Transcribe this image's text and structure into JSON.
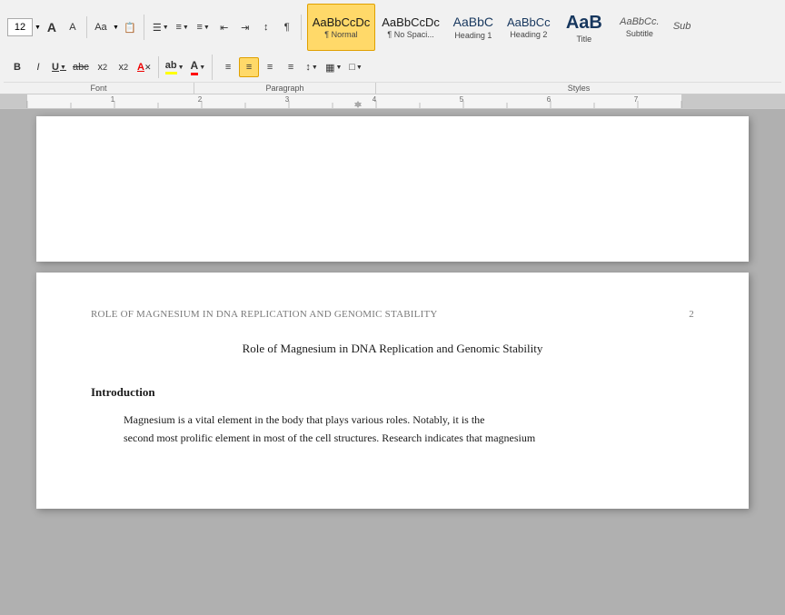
{
  "toolbar": {
    "font_size": "12",
    "row1": {
      "font_size_label": "12",
      "grow_btn": "A",
      "shrink_btn": "A",
      "font_name": "Aa",
      "copy_format": "copy-format",
      "bullets_btn": "≡",
      "numbered_btn": "≡",
      "multilevel_btn": "≡",
      "decrease_indent": "⇤",
      "increase_indent": "⇥",
      "sort_btn": "↕",
      "show_marks": "¶"
    },
    "row2": {
      "bold": "B",
      "italic": "I",
      "underline": "U",
      "strikethrough": "S",
      "subscript": "x₂",
      "superscript": "x²",
      "clear_fmt": "A",
      "highlight": "ab",
      "font_color": "A",
      "align_left": "≡",
      "align_center": "≡",
      "align_right": "≡",
      "justify": "≡",
      "line_spacing": "↕",
      "shading": "▦",
      "borders": "□"
    }
  },
  "styles": {
    "normal": {
      "preview": "AaBbCcDc",
      "label": "¶ Normal",
      "active": true
    },
    "no_spacing": {
      "preview": "AaBbCcDc",
      "label": "¶ No Spaci..."
    },
    "heading1": {
      "preview": "AaBbC",
      "label": "Heading 1"
    },
    "heading2": {
      "preview": "AaBbCc",
      "label": "Heading 2"
    },
    "title": {
      "preview": "AaB",
      "label": "Title"
    },
    "subtitle": {
      "preview": "AaBbCc.",
      "label": "Subtitle"
    },
    "more": {
      "preview": "Sub",
      "label": ""
    }
  },
  "ribbon_sections": {
    "font": "Font",
    "paragraph": "Paragraph",
    "styles": "Styles"
  },
  "document": {
    "page2": {
      "running_head": "ROLE OF MAGNESIUM IN DNA REPLICATION AND GENOMIC STABILITY",
      "page_number": "2",
      "title": "Role of Magnesium in DNA Replication and Genomic Stability",
      "introduction_heading": "Introduction",
      "paragraph1": "Magnesium is a vital element in the body that plays various roles.  Notably, it is the",
      "paragraph2": "second most prolific element in most of the cell structures.  Research indicates that magnesium"
    }
  }
}
